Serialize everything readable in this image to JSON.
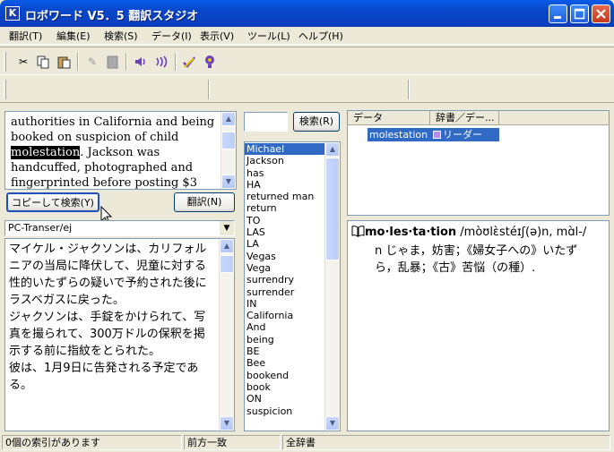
{
  "window": {
    "title": "ロボワード V5．5  翻訳スタジオ",
    "icon_letter": "K"
  },
  "menu": [
    "翻訳(T)",
    "編集(E)",
    "検索(S)",
    "データ(I)",
    "表示(V)",
    "ツール(L)",
    "ヘルプ(H)"
  ],
  "toolbar_icons": [
    "cut-icon",
    "copy-icon",
    "paste-icon",
    "speaker-icon",
    "speaker-wave-icon",
    "check-icon",
    "lightbulb-icon"
  ],
  "source": {
    "before": "authorities in California and being booked on suspicion of child ",
    "highlight": "molestation",
    "after": ". Jackson was handcuffed, photographed and fingerprinted before posting $3"
  },
  "buttons": {
    "copy_search": "コピーして検索(Y)",
    "translate": "翻訳(N)",
    "search": "検索(R)"
  },
  "engine": {
    "selected": "PC-Transer/ej"
  },
  "translation": {
    "paragraphs": [
      "マイケル・ジャクソンは、カリフォルニアの当局に降伏して、児童に対する性的いたずらの疑いで予約された後にラスベガスに戻った。",
      "ジャクソンは、手錠をかけられて、写真を撮られて、300万ドルの保釈を掲示する前に指紋をとられた。",
      "彼は、1月9日に告発される予定である。"
    ]
  },
  "search": {
    "value": ""
  },
  "word_list": [
    "Michael",
    "Jackson",
    "has",
    "HA",
    "returned man",
    "return",
    "TO",
    "LAS",
    "LA",
    "Vegas",
    "Vega",
    "surrendry",
    "surrender",
    "IN",
    "California",
    "And",
    "being",
    "BE",
    "Bee",
    "bookend",
    "book",
    "ON",
    "suspicion"
  ],
  "results": {
    "columns": [
      "データ",
      "辞書／デー..."
    ],
    "rows": [
      {
        "data": "molestation",
        "dict": "リーダーズ..."
      }
    ]
  },
  "definition": {
    "headword": "mo·les·ta·tion",
    "pron": " /mòʊlɛ̀stéɪʃ(ə)n, mɑ̀l-/",
    "body": "n じゃま，妨害；《婦女子への》いたずら，乱暴；《古》苦悩（の種）."
  },
  "status": [
    "0個の索引があります",
    "前方一致",
    "全辞書"
  ],
  "colors": {
    "selection": "#316ac5",
    "titlebar": "#0a5ce8"
  }
}
